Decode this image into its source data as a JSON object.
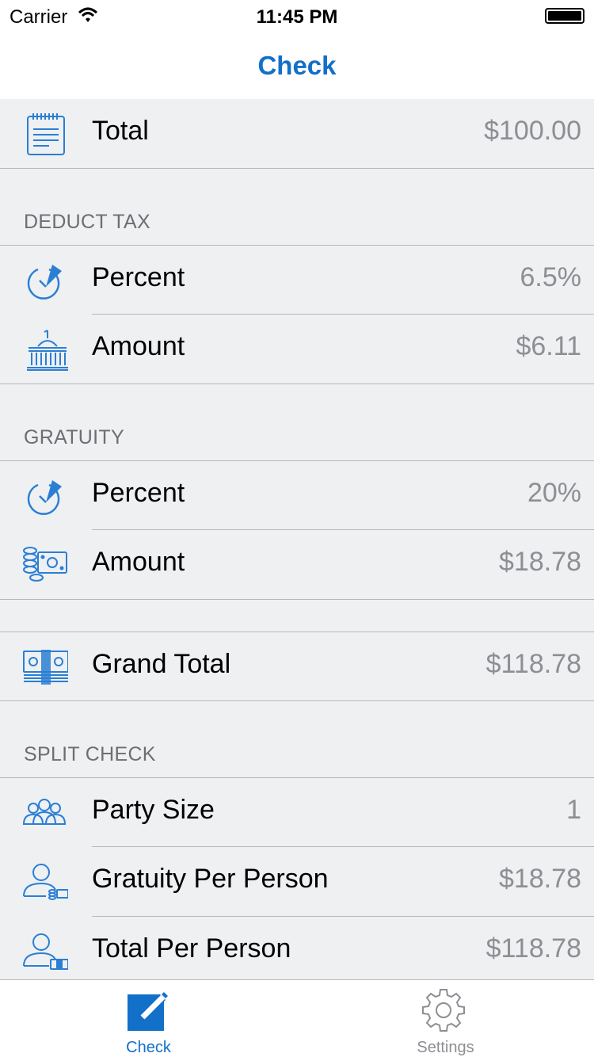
{
  "status_bar": {
    "carrier": "Carrier",
    "time": "11:45 PM"
  },
  "nav": {
    "title": "Check"
  },
  "total": {
    "label": "Total",
    "value": "$100.00",
    "icon": "receipt-icon"
  },
  "deduct_tax": {
    "header": "DEDUCT TAX",
    "percent": {
      "label": "Percent",
      "value": "6.5%",
      "icon": "pie-percent-icon"
    },
    "amount": {
      "label": "Amount",
      "value": "$6.11",
      "icon": "capitol-building-icon"
    }
  },
  "gratuity": {
    "header": "GRATUITY",
    "percent": {
      "label": "Percent",
      "value": "20%",
      "icon": "pie-percent-icon"
    },
    "amount": {
      "label": "Amount",
      "value": "$18.78",
      "icon": "coins-bill-icon"
    }
  },
  "grand_total": {
    "label": "Grand Total",
    "value": "$118.78",
    "icon": "money-stack-icon"
  },
  "split_check": {
    "header": "SPLIT CHECK",
    "party_size": {
      "label": "Party Size",
      "value": "1",
      "icon": "group-people-icon"
    },
    "gratuity_per_person": {
      "label": "Gratuity Per Person",
      "value": "$18.78",
      "icon": "person-coins-icon"
    },
    "total_per_person": {
      "label": "Total Per Person",
      "value": "$118.78",
      "icon": "person-money-icon"
    }
  },
  "tab_bar": {
    "tabs": [
      {
        "label": "Check",
        "icon": "pencil-square-icon",
        "selected": true
      },
      {
        "label": "Settings",
        "icon": "gear-icon",
        "selected": false
      }
    ]
  },
  "colors": {
    "accent": "#1270c9",
    "icon_blue": "#2a7fd4",
    "value_gray": "#8e8e93",
    "background": "#eef0f2"
  }
}
